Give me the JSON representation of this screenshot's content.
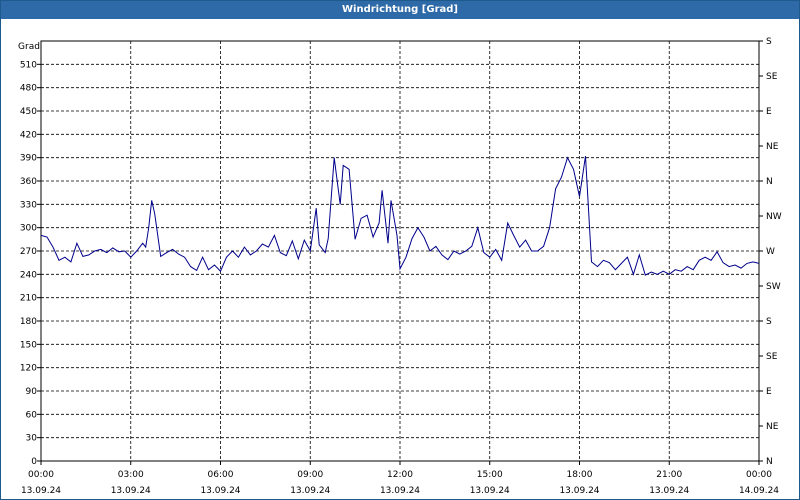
{
  "window": {
    "title": "Windrichtung [Grad]"
  },
  "chart_data": {
    "type": "line",
    "title": "Windrichtung [Grad]",
    "ylabel": "Grad",
    "ylim": [
      0,
      540
    ],
    "y_ticks": [
      0,
      30,
      60,
      90,
      120,
      150,
      180,
      210,
      240,
      270,
      300,
      330,
      360,
      390,
      420,
      450,
      480,
      510
    ],
    "x_ticks": [
      {
        "time": "00:00",
        "date": "13.09.24"
      },
      {
        "time": "03:00",
        "date": "13.09.24"
      },
      {
        "time": "06:00",
        "date": "13.09.24"
      },
      {
        "time": "09:00",
        "date": "13.09.24"
      },
      {
        "time": "12:00",
        "date": "13.09.24"
      },
      {
        "time": "15:00",
        "date": "13.09.24"
      },
      {
        "time": "18:00",
        "date": "13.09.24"
      },
      {
        "time": "21:00",
        "date": "13.09.24"
      },
      {
        "time": "00:00",
        "date": "14.09.24"
      }
    ],
    "xlim_hours": [
      0,
      24
    ],
    "right_axis": [
      {
        "label": "S",
        "value": 540
      },
      {
        "label": "SE",
        "value": 495
      },
      {
        "label": "E",
        "value": 450
      },
      {
        "label": "NE",
        "value": 405
      },
      {
        "label": "N",
        "value": 360
      },
      {
        "label": "NW",
        "value": 315
      },
      {
        "label": "W",
        "value": 270
      },
      {
        "label": "SW",
        "value": 225
      },
      {
        "label": "S",
        "value": 180
      },
      {
        "label": "SE",
        "value": 135
      },
      {
        "label": "E",
        "value": 90
      },
      {
        "label": "NE",
        "value": 45
      },
      {
        "label": "N",
        "value": 0
      }
    ],
    "grid": true,
    "colors": {
      "line": "#00008b",
      "title_bar": "#2e6aa8"
    },
    "series": [
      {
        "points": [
          [
            0.0,
            290
          ],
          [
            0.2,
            288
          ],
          [
            0.4,
            275
          ],
          [
            0.6,
            258
          ],
          [
            0.8,
            262
          ],
          [
            1.0,
            256
          ],
          [
            1.2,
            280
          ],
          [
            1.4,
            263
          ],
          [
            1.6,
            265
          ],
          [
            1.8,
            270
          ],
          [
            2.0,
            272
          ],
          [
            2.2,
            268
          ],
          [
            2.4,
            274
          ],
          [
            2.6,
            269
          ],
          [
            2.8,
            270
          ],
          [
            3.0,
            262
          ],
          [
            3.2,
            270
          ],
          [
            3.4,
            280
          ],
          [
            3.5,
            275
          ],
          [
            3.6,
            300
          ],
          [
            3.7,
            335
          ],
          [
            3.8,
            318
          ],
          [
            4.0,
            263
          ],
          [
            4.2,
            268
          ],
          [
            4.4,
            272
          ],
          [
            4.6,
            266
          ],
          [
            4.8,
            262
          ],
          [
            5.0,
            250
          ],
          [
            5.2,
            245
          ],
          [
            5.4,
            262
          ],
          [
            5.6,
            246
          ],
          [
            5.8,
            252
          ],
          [
            6.0,
            244
          ],
          [
            6.2,
            262
          ],
          [
            6.4,
            270
          ],
          [
            6.6,
            262
          ],
          [
            6.8,
            275
          ],
          [
            7.0,
            265
          ],
          [
            7.2,
            270
          ],
          [
            7.4,
            279
          ],
          [
            7.6,
            275
          ],
          [
            7.8,
            290
          ],
          [
            8.0,
            268
          ],
          [
            8.2,
            264
          ],
          [
            8.4,
            283
          ],
          [
            8.6,
            260
          ],
          [
            8.8,
            284
          ],
          [
            9.0,
            270
          ],
          [
            9.2,
            325
          ],
          [
            9.3,
            278
          ],
          [
            9.5,
            268
          ],
          [
            9.6,
            286
          ],
          [
            9.8,
            390
          ],
          [
            10.0,
            330
          ],
          [
            10.1,
            380
          ],
          [
            10.3,
            375
          ],
          [
            10.5,
            285
          ],
          [
            10.7,
            312
          ],
          [
            10.9,
            316
          ],
          [
            11.1,
            288
          ],
          [
            11.3,
            306
          ],
          [
            11.4,
            348
          ],
          [
            11.6,
            280
          ],
          [
            11.7,
            335
          ],
          [
            11.9,
            290
          ],
          [
            12.0,
            247
          ],
          [
            12.2,
            262
          ],
          [
            12.4,
            286
          ],
          [
            12.6,
            300
          ],
          [
            12.8,
            288
          ],
          [
            13.0,
            270
          ],
          [
            13.2,
            276
          ],
          [
            13.4,
            265
          ],
          [
            13.6,
            259
          ],
          [
            13.8,
            270
          ],
          [
            14.0,
            266
          ],
          [
            14.2,
            270
          ],
          [
            14.4,
            276
          ],
          [
            14.6,
            300
          ],
          [
            14.8,
            268
          ],
          [
            15.0,
            262
          ],
          [
            15.2,
            272
          ],
          [
            15.4,
            258
          ],
          [
            15.6,
            306
          ],
          [
            15.8,
            290
          ],
          [
            16.0,
            275
          ],
          [
            16.2,
            284
          ],
          [
            16.4,
            270
          ],
          [
            16.6,
            270
          ],
          [
            16.8,
            276
          ],
          [
            17.0,
            300
          ],
          [
            17.2,
            350
          ],
          [
            17.4,
            365
          ],
          [
            17.6,
            390
          ],
          [
            17.8,
            375
          ],
          [
            18.0,
            340
          ],
          [
            18.2,
            392
          ],
          [
            18.4,
            256
          ],
          [
            18.6,
            250
          ],
          [
            18.8,
            258
          ],
          [
            19.0,
            255
          ],
          [
            19.2,
            246
          ],
          [
            19.4,
            254
          ],
          [
            19.6,
            262
          ],
          [
            19.8,
            240
          ],
          [
            20.0,
            265
          ],
          [
            20.2,
            239
          ],
          [
            20.4,
            243
          ],
          [
            20.6,
            240
          ],
          [
            20.8,
            244
          ],
          [
            21.0,
            240
          ],
          [
            21.2,
            246
          ],
          [
            21.4,
            244
          ],
          [
            21.6,
            250
          ],
          [
            21.8,
            246
          ],
          [
            22.0,
            258
          ],
          [
            22.2,
            262
          ],
          [
            22.4,
            258
          ],
          [
            22.6,
            269
          ],
          [
            22.8,
            255
          ],
          [
            23.0,
            250
          ],
          [
            23.2,
            252
          ],
          [
            23.4,
            248
          ],
          [
            23.6,
            254
          ],
          [
            23.8,
            256
          ],
          [
            24.0,
            254
          ]
        ]
      }
    ]
  }
}
